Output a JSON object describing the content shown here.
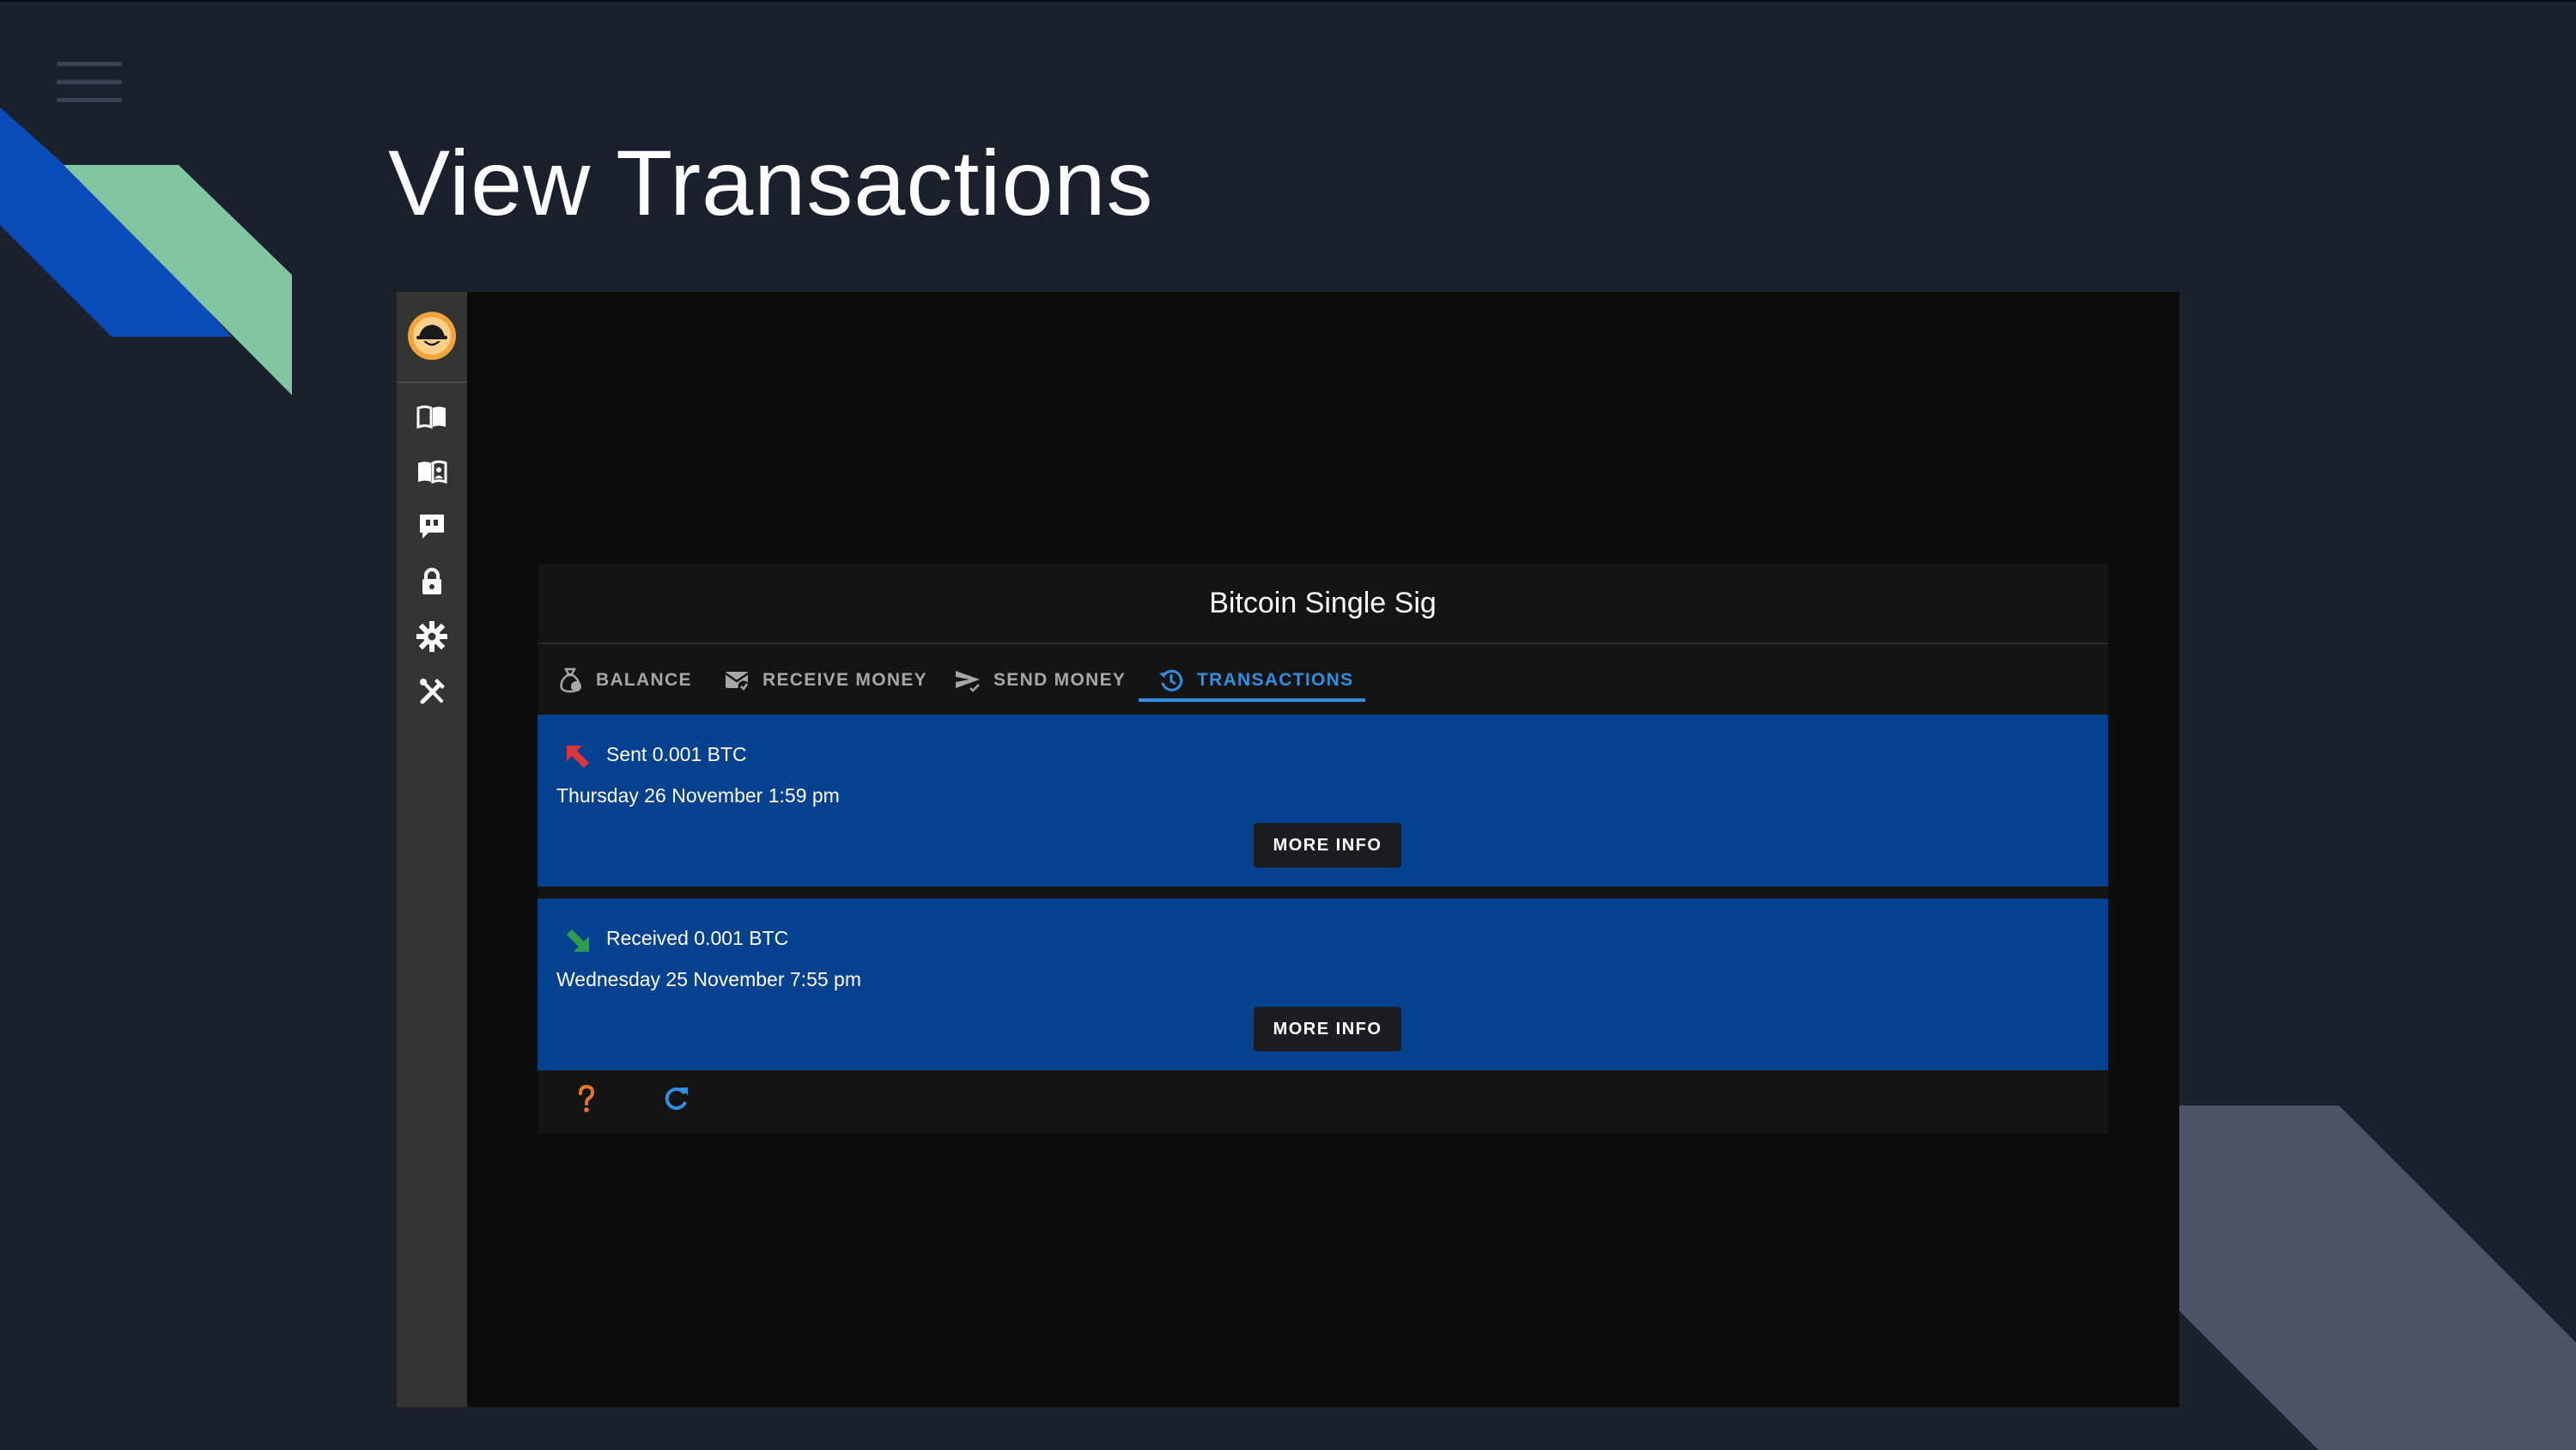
{
  "slide": {
    "title": "View Transactions"
  },
  "app": {
    "sidebar": {
      "items": [
        {
          "name": "book-open-icon"
        },
        {
          "name": "book-user-icon"
        },
        {
          "name": "quote-bubble-icon"
        },
        {
          "name": "lock-icon"
        },
        {
          "name": "gear-icon"
        },
        {
          "name": "tools-icon"
        }
      ]
    },
    "wallet": {
      "title": "Bitcoin Single Sig",
      "tabs": [
        {
          "label": "BALANCE",
          "icon": "money-bag-icon"
        },
        {
          "label": "RECEIVE MONEY",
          "icon": "mail-receive-icon"
        },
        {
          "label": "SEND MONEY",
          "icon": "send-icon"
        },
        {
          "label": "TRANSACTIONS",
          "icon": "history-icon",
          "active": true
        }
      ],
      "transactions": [
        {
          "direction": "sent",
          "amount": "Sent 0.001 BTC",
          "date": "Thursday 26 November 1:59 pm",
          "button": "MORE INFO"
        },
        {
          "direction": "received",
          "amount": "Received 0.001 BTC",
          "date": "Wednesday 25 November 7:55 pm",
          "button": "MORE INFO"
        }
      ],
      "footer_icons": [
        "help-icon",
        "refresh-icon"
      ]
    }
  },
  "colors": {
    "background": "#1b202d",
    "accent": "#2f8fe2",
    "card": "#04418e",
    "sent": "#d9363e",
    "received": "#2e9e4a",
    "help": "#e8762c"
  }
}
